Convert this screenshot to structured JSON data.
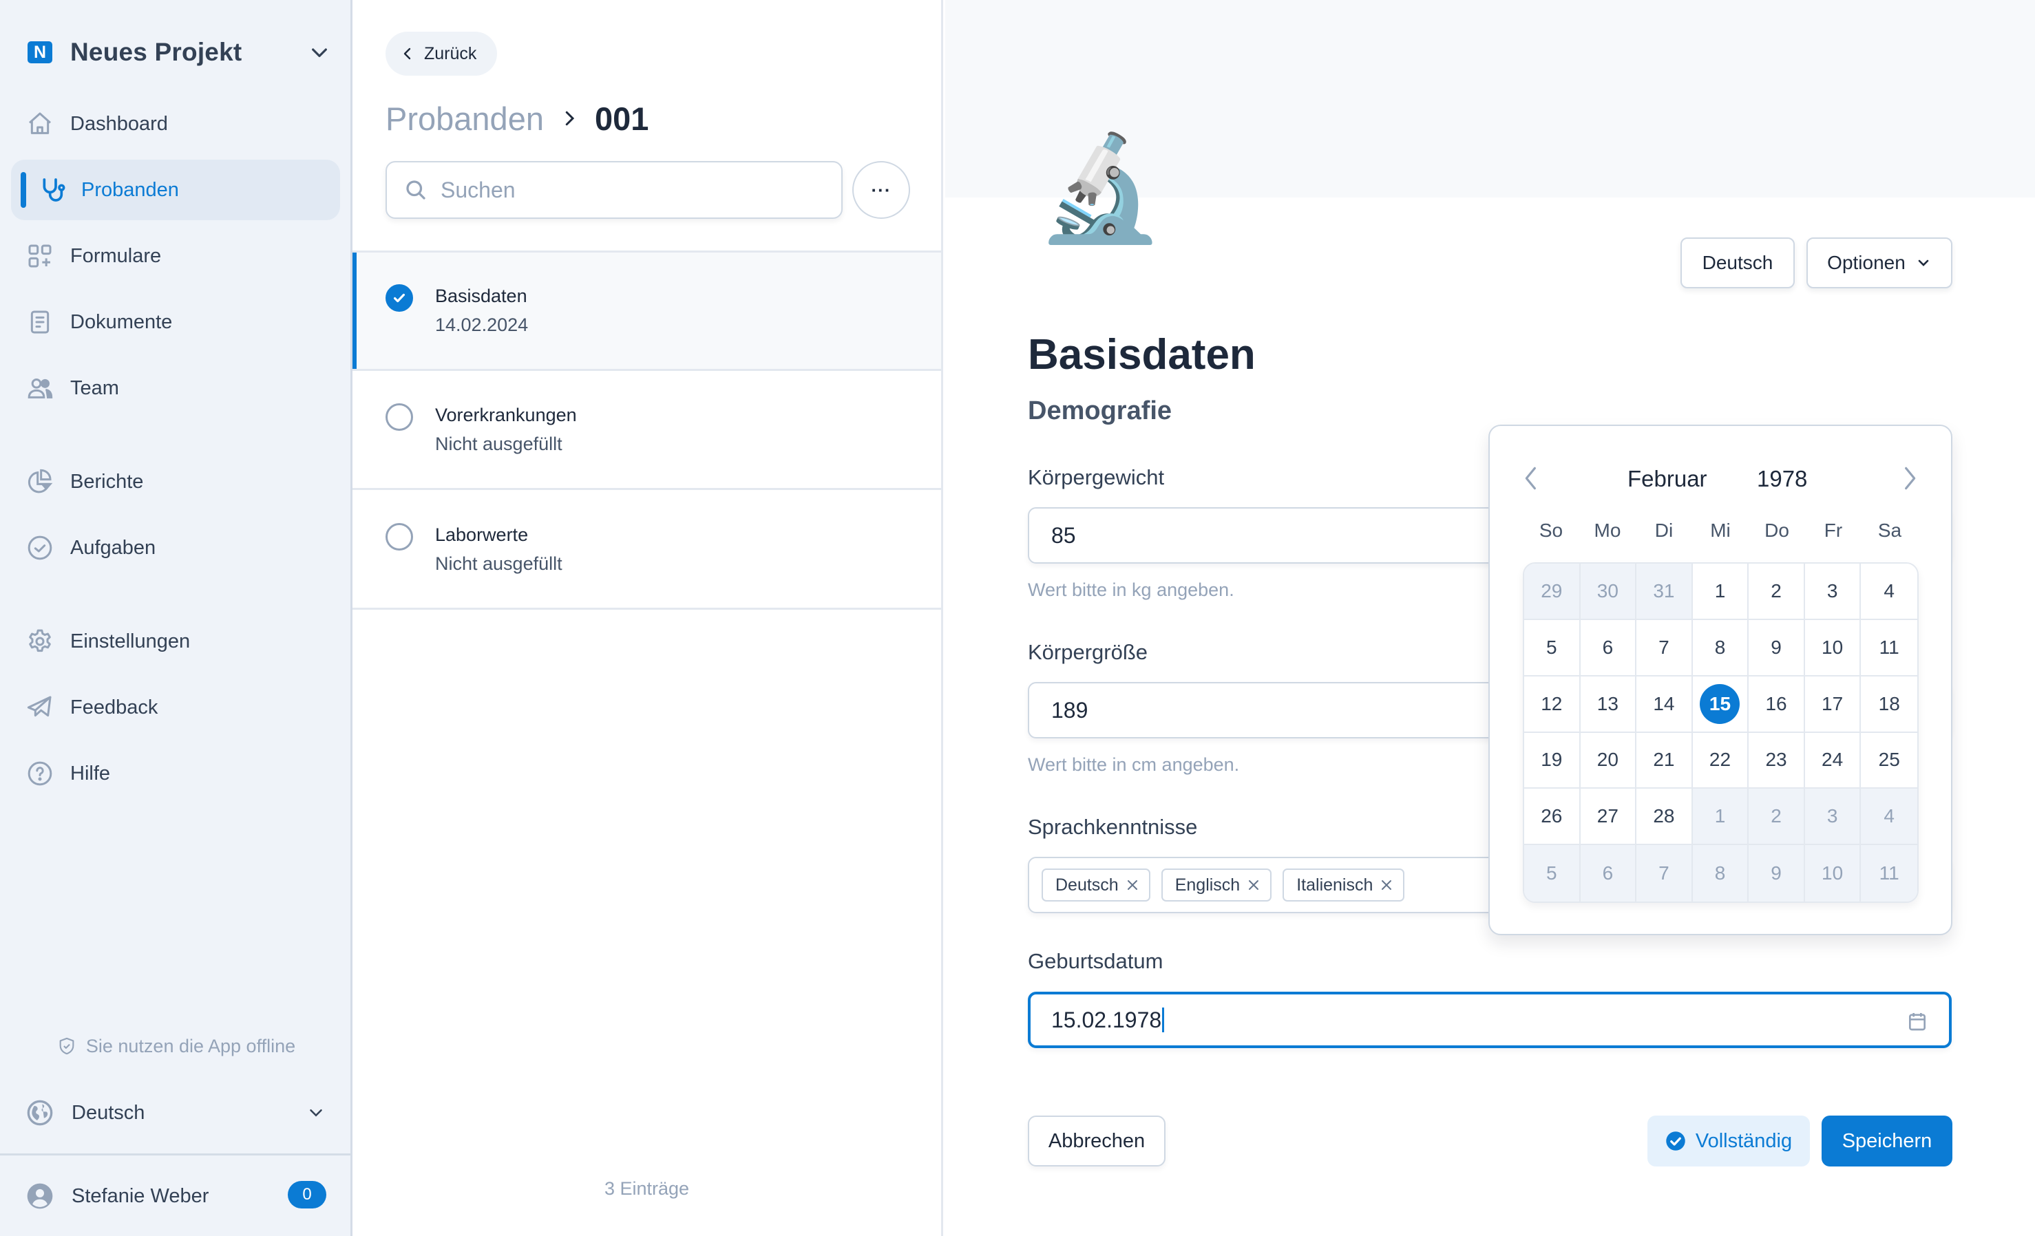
{
  "colors": {
    "accent": "#0b7bd4",
    "sidebar_bg": "#eff3f9",
    "muted_text": "#94a3b8"
  },
  "sidebar": {
    "project": {
      "logo_letter": "N",
      "name": "Neues Projekt"
    },
    "items": [
      {
        "label": "Dashboard",
        "icon": "home-icon"
      },
      {
        "label": "Probanden",
        "icon": "stethoscope-icon",
        "active": true
      },
      {
        "label": "Formulare",
        "icon": "grid-plus-icon"
      },
      {
        "label": "Dokumente",
        "icon": "document-icon"
      },
      {
        "label": "Team",
        "icon": "users-icon"
      },
      {
        "label": "Berichte",
        "icon": "pie-chart-icon"
      },
      {
        "label": "Aufgaben",
        "icon": "check-circle-icon"
      },
      {
        "label": "Einstellungen",
        "icon": "gear-icon"
      },
      {
        "label": "Feedback",
        "icon": "paper-plane-icon"
      },
      {
        "label": "Hilfe",
        "icon": "help-circle-icon"
      }
    ],
    "offline_note": "Sie nutzen die App offline",
    "language": "Deutsch",
    "user": {
      "name": "Stefanie Weber",
      "badge_count": "0"
    }
  },
  "middle": {
    "back_label": "Zurück",
    "breadcrumb": {
      "parent": "Probanden",
      "current": "001"
    },
    "search": {
      "placeholder": "Suchen",
      "value": ""
    },
    "more_label": "···",
    "list": [
      {
        "title": "Basisdaten",
        "subtitle": "14.02.2024",
        "status": "complete",
        "selected": true
      },
      {
        "title": "Vorerkrankungen",
        "subtitle": "Nicht ausgefüllt",
        "status": "empty"
      },
      {
        "title": "Laborwerte",
        "subtitle": "Nicht ausgefüllt",
        "status": "empty"
      }
    ],
    "count_label": "3 Einträge"
  },
  "form": {
    "emoji": "🔬",
    "language_button": "Deutsch",
    "options_button": "Optionen",
    "title": "Basisdaten",
    "section": "Demografie",
    "fields": {
      "weight": {
        "label": "Körpergewicht",
        "value": "85",
        "hint": "Wert bitte in kg angeben."
      },
      "height": {
        "label": "Körpergröße",
        "value": "189",
        "hint": "Wert bitte in cm angeben."
      },
      "languages": {
        "label": "Sprachkenntnisse",
        "tags": [
          "Deutsch",
          "Englisch",
          "Italienisch"
        ]
      },
      "birthdate": {
        "label": "Geburtsdatum",
        "value": "15.02.1978"
      }
    },
    "buttons": {
      "cancel": "Abbrechen",
      "status": "Vollständig",
      "save": "Speichern"
    }
  },
  "calendar": {
    "month": "Februar",
    "year": "1978",
    "weekdays": [
      "So",
      "Mo",
      "Di",
      "Mi",
      "Do",
      "Fr",
      "Sa"
    ],
    "selected_day": "15",
    "weeks": [
      [
        {
          "d": "29",
          "out": true
        },
        {
          "d": "30",
          "out": true
        },
        {
          "d": "31",
          "out": true
        },
        {
          "d": "1"
        },
        {
          "d": "2"
        },
        {
          "d": "3"
        },
        {
          "d": "4"
        }
      ],
      [
        {
          "d": "5"
        },
        {
          "d": "6"
        },
        {
          "d": "7"
        },
        {
          "d": "8"
        },
        {
          "d": "9"
        },
        {
          "d": "10"
        },
        {
          "d": "11"
        }
      ],
      [
        {
          "d": "12"
        },
        {
          "d": "13"
        },
        {
          "d": "14"
        },
        {
          "d": "15",
          "sel": true
        },
        {
          "d": "16"
        },
        {
          "d": "17"
        },
        {
          "d": "18"
        }
      ],
      [
        {
          "d": "19"
        },
        {
          "d": "20"
        },
        {
          "d": "21"
        },
        {
          "d": "22"
        },
        {
          "d": "23"
        },
        {
          "d": "24"
        },
        {
          "d": "25"
        }
      ],
      [
        {
          "d": "26"
        },
        {
          "d": "27"
        },
        {
          "d": "28"
        },
        {
          "d": "1",
          "out": true
        },
        {
          "d": "2",
          "out": true
        },
        {
          "d": "3",
          "out": true
        },
        {
          "d": "4",
          "out": true
        }
      ],
      [
        {
          "d": "5",
          "out": true
        },
        {
          "d": "6",
          "out": true
        },
        {
          "d": "7",
          "out": true
        },
        {
          "d": "8",
          "out": true
        },
        {
          "d": "9",
          "out": true
        },
        {
          "d": "10",
          "out": true
        },
        {
          "d": "11",
          "out": true
        }
      ]
    ]
  }
}
